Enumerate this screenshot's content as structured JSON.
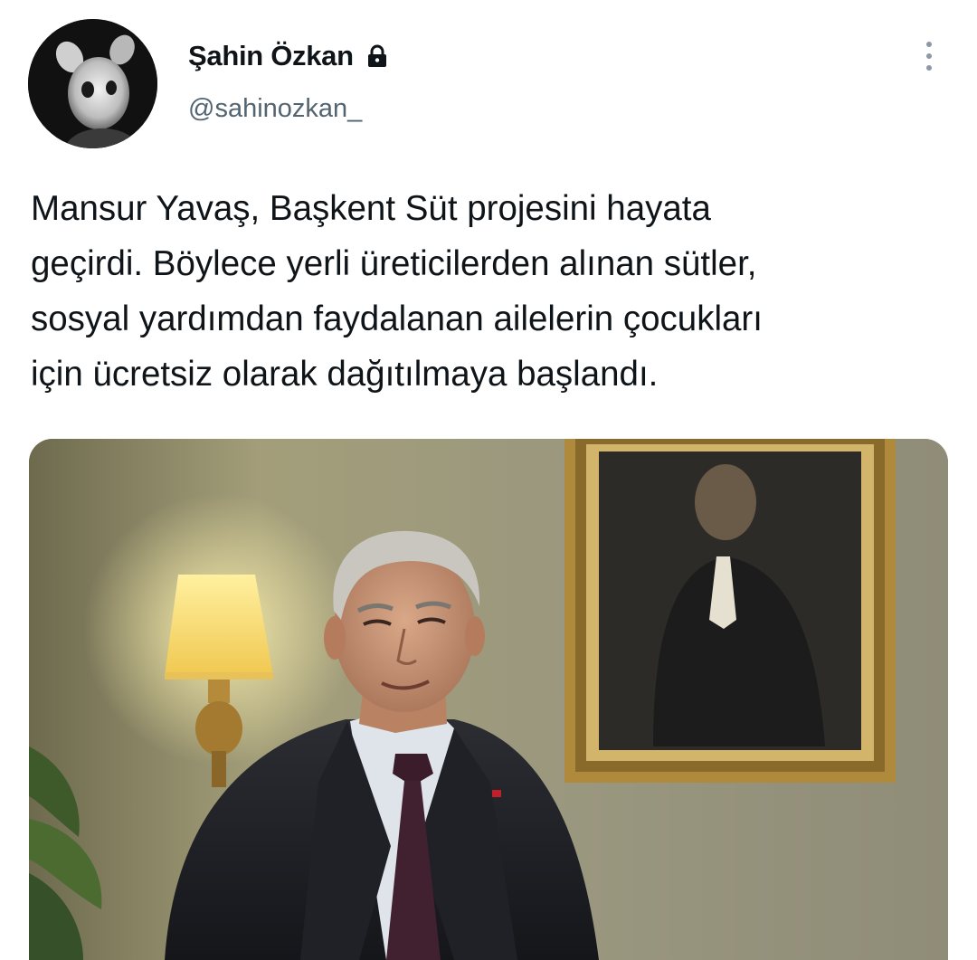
{
  "tweet": {
    "author": {
      "display_name": "Şahin Özkan",
      "handle": "@sahinozkan_",
      "protected_icon": "lock-icon",
      "avatar_icon": "avatar-image"
    },
    "more_icon": "more-vertical-icon",
    "text": "Mansur Yavaş, Başkent Süt projesini hayata\ngeçirdi. Böylece yerli üreticilerden alınan sütler,\nsosyal yardımdan faydalanan ailelerin çocukları\niçin ücretsiz olarak dağıtılmaya başlandı.",
    "media": {
      "type": "photo"
    }
  },
  "colors": {
    "text_primary": "#0f1419",
    "text_secondary": "#536471",
    "background": "#ffffff"
  }
}
